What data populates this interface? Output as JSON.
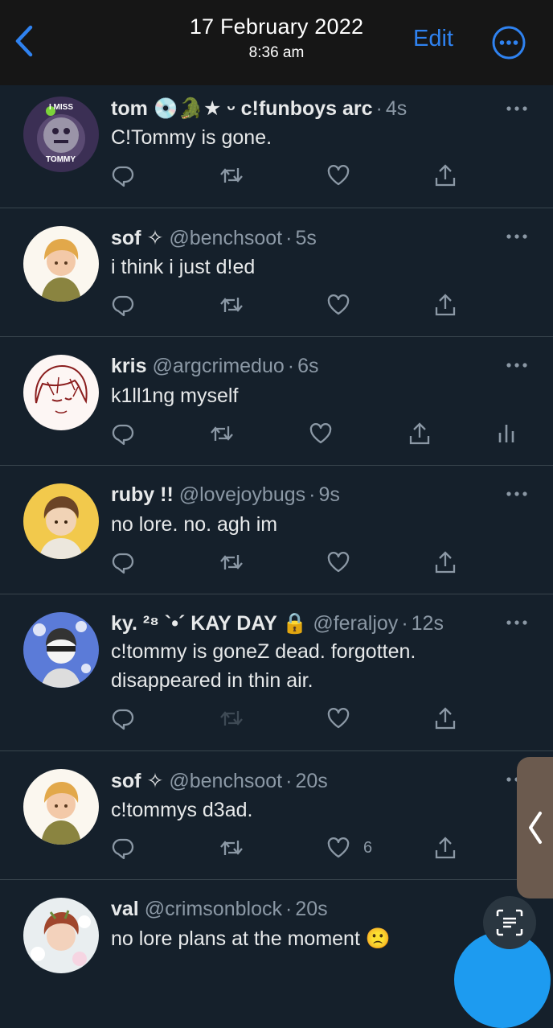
{
  "header": {
    "date": "17 February 2022",
    "time": "8:36 am",
    "edit_label": "Edit",
    "accent_color": "#2f82f0"
  },
  "tweets": [
    {
      "name": "tom 💿🐊★ ᵕ c!funboys arc",
      "handle": "",
      "time": "4s",
      "text": "C!Tommy is gone.",
      "avatar_text_top": "I MISS",
      "avatar_text_bottom": "TOMMY",
      "like_count": "",
      "analytics": false
    },
    {
      "name": "sof ✧",
      "handle": "@benchsoot",
      "time": "5s",
      "text": "i think i just d!ed",
      "like_count": "",
      "analytics": false
    },
    {
      "name": "kris",
      "handle": "@argcrimeduo",
      "time": "6s",
      "text": "k1ll1ng myself",
      "like_count": "",
      "analytics": true
    },
    {
      "name": "ruby !!",
      "handle": "@lovejoybugs",
      "time": "9s",
      "text": "no lore. no. agh im",
      "like_count": "",
      "analytics": false
    },
    {
      "name": "ky. ²⁸ `•´ KAY DAY 🔒",
      "handle": "@feraljoy",
      "time": "12s",
      "text": "c!tommy is goneZ dead. forgotten.\ndisappeared in thin air.",
      "like_count": "",
      "analytics": false
    },
    {
      "name": "sof ✧",
      "handle": "@benchsoot",
      "time": "20s",
      "text": "c!tommys d3ad.",
      "like_count": "6",
      "analytics": false
    },
    {
      "name": "val",
      "handle": "@crimsonblock",
      "time": "20s",
      "text": "no lore plans at the moment 🙁",
      "like_count": "",
      "analytics": false
    }
  ],
  "icons": {
    "back": "chevron-left-icon",
    "more": "more-circle-icon",
    "reply": "reply-icon",
    "retweet": "retweet-icon",
    "like": "heart-icon",
    "share": "share-icon",
    "analytics": "analytics-icon",
    "scan": "text-scan-icon"
  },
  "colors": {
    "background": "#15202b",
    "divider": "#38444d",
    "muted": "#8b98a5",
    "compose": "#1d9bf0"
  }
}
